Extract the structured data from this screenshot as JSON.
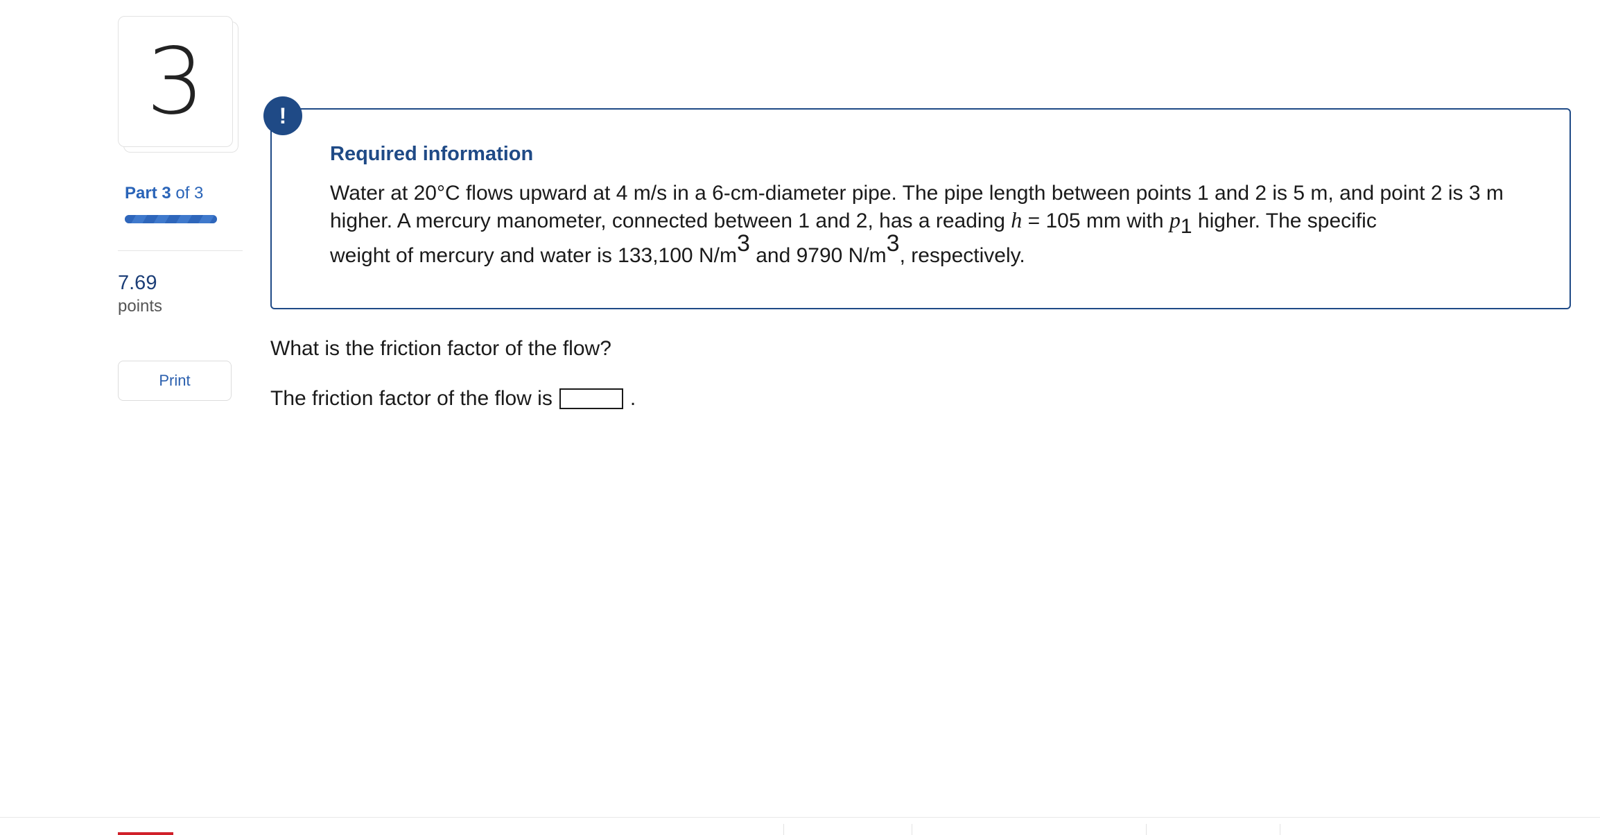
{
  "question_number": "3",
  "part": {
    "label_bold": "Part 3",
    "label_rest": "of 3",
    "progress_fraction": 1.0
  },
  "points": {
    "value": "7.69",
    "label": "points"
  },
  "print_button": "Print",
  "alert_icon": "!",
  "required_info": {
    "title": "Required information",
    "seg1": "Water at 20°C flows upward at 4 m/s in a 6-cm-diameter pipe. The pipe length between points 1 and 2 is 5 m, and point 2 is 3 m higher. A mercury manometer, connected between 1 and 2, has a reading ",
    "h_symbol": "h",
    "seg2": " = 105 mm with ",
    "p_symbol": "p",
    "p_sub": "1",
    "seg3": " higher. The specific",
    "seg4": "weight of mercury and water is 133,100 N/m",
    "sup1": "3",
    "seg5": " and 9790 N/m",
    "sup2": "3",
    "seg6": ", respectively."
  },
  "question": "What is the friction factor of the flow?",
  "answer": {
    "prefix": "The friction factor of the flow is",
    "value": "",
    "suffix": "."
  },
  "colors": {
    "primary": "#1f4a86",
    "link": "#2a64b8",
    "accent_red": "#d0202a"
  }
}
